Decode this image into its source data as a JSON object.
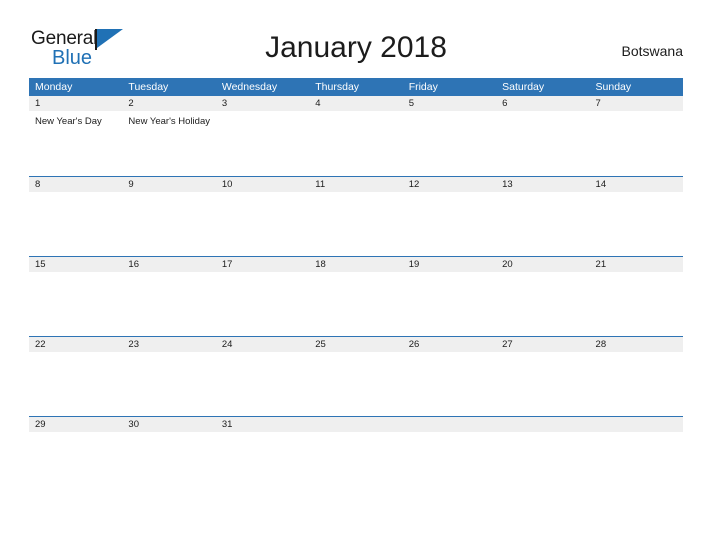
{
  "brand": {
    "name_part1": "General",
    "name_part2": "Blue",
    "flag_icon": "flag-icon",
    "accent_color": "#2071b5"
  },
  "header": {
    "title": "January 2018",
    "country": "Botswana"
  },
  "calendar": {
    "header_bg": "#2e74b5",
    "date_strip_bg": "#efefef",
    "weekdays": [
      "Monday",
      "Tuesday",
      "Wednesday",
      "Thursday",
      "Friday",
      "Saturday",
      "Sunday"
    ],
    "weeks": [
      {
        "dates": [
          "1",
          "2",
          "3",
          "4",
          "5",
          "6",
          "7"
        ],
        "events": [
          "New Year's Day",
          "New Year's Holiday",
          "",
          "",
          "",
          "",
          ""
        ]
      },
      {
        "dates": [
          "8",
          "9",
          "10",
          "11",
          "12",
          "13",
          "14"
        ],
        "events": [
          "",
          "",
          "",
          "",
          "",
          "",
          ""
        ]
      },
      {
        "dates": [
          "15",
          "16",
          "17",
          "18",
          "19",
          "20",
          "21"
        ],
        "events": [
          "",
          "",
          "",
          "",
          "",
          "",
          ""
        ]
      },
      {
        "dates": [
          "22",
          "23",
          "24",
          "25",
          "26",
          "27",
          "28"
        ],
        "events": [
          "",
          "",
          "",
          "",
          "",
          "",
          ""
        ]
      },
      {
        "dates": [
          "29",
          "30",
          "31",
          "",
          "",
          "",
          ""
        ],
        "events": [
          "",
          "",
          "",
          "",
          "",
          "",
          ""
        ]
      }
    ]
  }
}
